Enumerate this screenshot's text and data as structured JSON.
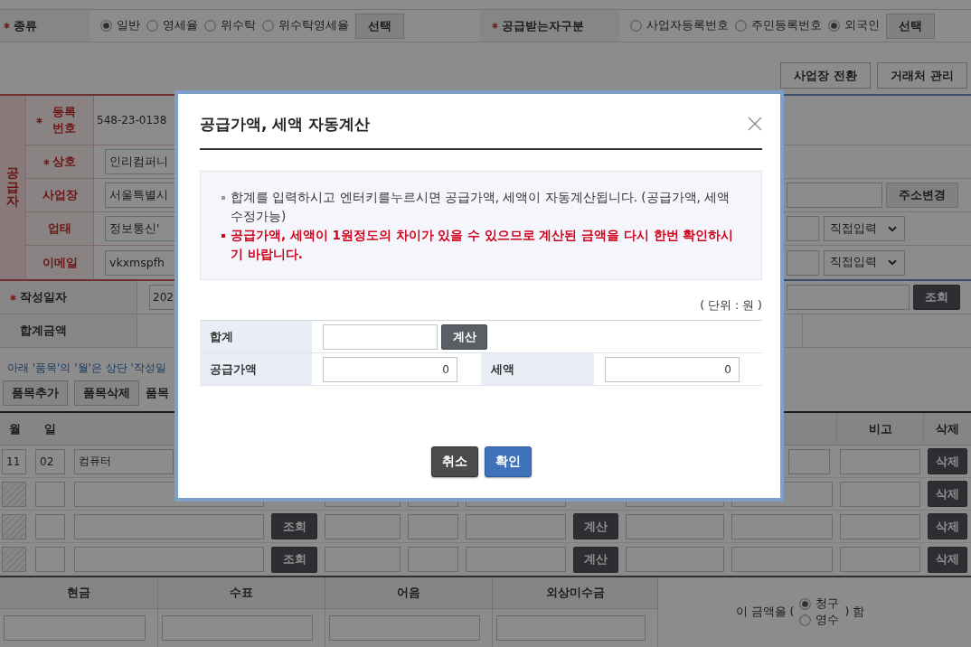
{
  "invoice_type": {
    "label": "종류",
    "required": true,
    "options": [
      {
        "label": "일반",
        "selected": true
      },
      {
        "label": "영세율",
        "selected": false
      },
      {
        "label": "위수탁",
        "selected": false
      },
      {
        "label": "위수탁영세율",
        "selected": false
      }
    ],
    "button": "선택"
  },
  "recipient_type": {
    "label": "공급받는자구분",
    "required": true,
    "options": [
      {
        "label": "사업자등록번호",
        "selected": false
      },
      {
        "label": "주민등록번호",
        "selected": false
      },
      {
        "label": "외국인",
        "selected": true
      }
    ],
    "button": "선택"
  },
  "toolbar": {
    "buttons": [
      "사업장 전환",
      "거래처 관리"
    ]
  },
  "supplier": {
    "title": "공급자",
    "rows": [
      {
        "label": "등록 번호",
        "required": true,
        "kind": "text",
        "value": "548-23-0138"
      },
      {
        "label": "상호",
        "required": true,
        "kind": "input",
        "value": "인리컴퍼니"
      },
      {
        "label": "사업장",
        "required": false,
        "kind": "input",
        "value": "서울특별시"
      },
      {
        "label": "업태",
        "required": false,
        "kind": "input",
        "value": "정보통신'"
      },
      {
        "label": "이메일",
        "required": false,
        "kind": "input",
        "value": "vkxmspfh"
      }
    ]
  },
  "recipient": {
    "rows": [
      {
        "kind": "address",
        "button": "주소변경"
      },
      {
        "kind": "select",
        "select": "직접입력"
      },
      {
        "kind": "select",
        "select": "직접입력"
      }
    ]
  },
  "date_row": {
    "label": "작성일자",
    "required": true,
    "value": "202",
    "button": "조회"
  },
  "total_row": {
    "label": "합계금액"
  },
  "items_note": "아래 '품목'의 '월'은 상단 '작성일",
  "item_buttons": [
    "품목추가",
    "품목삭제"
  ],
  "item_buttons_trailing_text": "품목",
  "items_table": {
    "columns": [
      "월",
      "일",
      "비고",
      "삭제"
    ],
    "rows": [
      {
        "month": "11",
        "month_locked": false,
        "day": "02",
        "item": "컴퓨터",
        "delete_button": "삭제"
      },
      {
        "month_locked": true,
        "delete_button": "삭제"
      },
      {
        "month_locked": true,
        "lookup_button": "조회",
        "calc_button": "계산",
        "delete_button": "삭제"
      },
      {
        "month_locked": true,
        "lookup_button": "조회",
        "calc_button": "계산",
        "delete_button": "삭제"
      }
    ]
  },
  "payment": {
    "columns": [
      "현금",
      "수표",
      "어음",
      "외상미수금"
    ],
    "claim": {
      "prefix": "이 금액을 (",
      "options": [
        {
          "label": "청구",
          "selected": true
        },
        {
          "label": "영수",
          "selected": false
        }
      ],
      "suffix": ") 함"
    }
  },
  "dialog": {
    "title": "공급가액, 세액 자동계산",
    "notes": [
      {
        "kind": "normal",
        "text": "합계를 입력하시고 엔터키를누르시면 공급가액, 세액이 자동계산됩니다. (공급가액, 세액 수정가능)"
      },
      {
        "kind": "warning",
        "text": "공급가액, 세액이 1원정도의 차이가 있을 수 있으므로 계산된 금액을 다시 한번 확인하시기 바랍니다."
      }
    ],
    "unit": "( 단위 : 원 )",
    "total": {
      "label": "합계",
      "button": "계산"
    },
    "supply": {
      "label": "공급가액",
      "value": "0"
    },
    "tax": {
      "label": "세액",
      "value": "0"
    },
    "buttons": [
      {
        "kind": "cancel",
        "label": "취소"
      },
      {
        "kind": "confirm",
        "label": "확인"
      }
    ]
  }
}
